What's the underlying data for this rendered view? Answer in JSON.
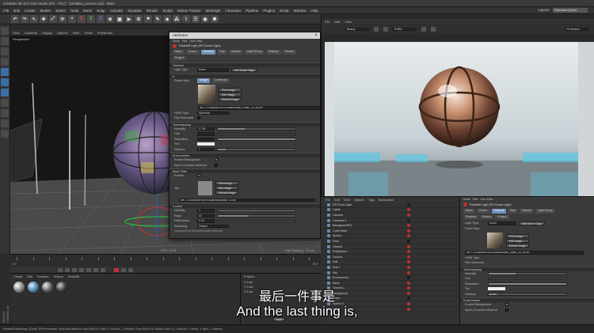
{
  "window": {
    "title": "CINEMA 4D R17.048 Studio (RC - R17) - [Untitled_Lesson.c4d] - Main"
  },
  "menubar": {
    "items": [
      "File",
      "Edit",
      "Create",
      "Modes",
      "Select",
      "Tools",
      "Mesh",
      "Snap",
      "Animate",
      "Simulate",
      "Render",
      "Sculpt",
      "Motion Tracker",
      "MoGraph",
      "Character",
      "Pipeline",
      "Plugins",
      "Script",
      "Window",
      "Help"
    ],
    "layout_label": "Layout:",
    "layout_value": "Standard (User)"
  },
  "toolbar": {
    "axis_x": "X",
    "axis_y": "Y",
    "axis_z": "Z"
  },
  "viewport": {
    "menu": [
      "View",
      "Cameras",
      "Display",
      "Options",
      "Filter",
      "Panel",
      "ProRender"
    ],
    "label": "Perspective",
    "fps": "FPS : 22.8",
    "grid": "Grid Spacing : 10 cm"
  },
  "attributes": {
    "title": "Attributes",
    "header": "Redshift Light (RS Dome Light)",
    "tabs": [
      "Basic",
      "Coord.",
      "General",
      "Ray",
      "Volume",
      "Light Group",
      "Shadow",
      "Photon",
      "Project"
    ],
    "active_tab": "General",
    "general_section": "General",
    "light_type_label": "Light Type",
    "light_type_value": "Dome",
    "add_dome_btn": "Add Dome Cage",
    "texture_map_label": "Dome Map",
    "tex_tab_image": "Image",
    "tex_tab_cubemap": "Cubemap",
    "btn_pick": "Pick Image...",
    "btn_edit": "Edit Image...",
    "btn_reload": "Reload Image",
    "path": "file: C:/Dropbox/HDRI/Studio/studio_small_03_4k.exr",
    "hdri_type_label": "HDRI Type",
    "hdri_type_value": "Spherical",
    "flip_label": "Flip Horizontal",
    "flip_value": "",
    "tone_section": "Tonemapping",
    "exposure_label": "Intensity",
    "exposure_value": "0.794",
    "hue_label": "Hue",
    "saturation_label": "Saturation",
    "tint_label": "Tint",
    "gamma_label": "Gamma",
    "gamma_value": "1",
    "environment_section": "Environment",
    "enable_bg_label": "Enable Background",
    "alpha_label": "Alpha Channel Influence",
    "back_plate_section": "Back Plate",
    "enable_bp_label": "Enable",
    "tex_label": "Tex",
    "bp_path": "file: C:/Dropbox/HDRI/Studio/backplate_01.jpg",
    "control_section": "Control",
    "visibility_label": "Visibility",
    "visibility_value": "1",
    "rays_label": "Rays",
    "rays_value": "64",
    "reflections_label": "Reflections",
    "reflections_value": "0.00",
    "sampling_label": "Sampling",
    "sampling_value": "Default",
    "foot_path": "/Applications/Cinema4D/plugins/Redshift"
  },
  "render_view": {
    "menu": [
      "File",
      "Edit",
      "View"
    ],
    "tool_a": "Beauty",
    "tool_b": "RGBA",
    "tool_c": "Fit Window"
  },
  "object_manager": {
    "menu": [
      "File",
      "Edit",
      "View",
      "Objects",
      "Tags",
      "Bookmarks"
    ],
    "rows": [
      {
        "name": "RS Dome Light",
        "tag": "b"
      },
      {
        "name": "Lights",
        "tag": "r"
      },
      {
        "name": "Camera",
        "tag": "r"
      },
      {
        "name": "Cameras.1",
        "tag": "b"
      },
      {
        "name": "BackgroundFill",
        "tag": "r"
      },
      {
        "name": "Cube.Mesh",
        "tag": "r"
      },
      {
        "name": "Sphere",
        "tag": "r"
      },
      {
        "name": "Floor",
        "tag": "b"
      },
      {
        "name": "Objects",
        "tag": "r"
      },
      {
        "name": "PolySphere",
        "tag": "r"
      },
      {
        "name": "Ground",
        "tag": "r"
      },
      {
        "name": "Null",
        "tag": "r"
      },
      {
        "name": "Null.1",
        "tag": "r"
      },
      {
        "name": "Sky",
        "tag": "r"
      },
      {
        "name": "Environment",
        "tag": "b"
      },
      {
        "name": "Mesh",
        "tag": "r"
      },
      {
        "name": "Ground.1",
        "tag": "r"
      },
      {
        "name": "Background",
        "tag": "r"
      },
      {
        "name": "Plane",
        "tag": "b"
      },
      {
        "name": "Sphere.1",
        "tag": "r"
      },
      {
        "name": "Null.2",
        "tag": "r"
      }
    ]
  },
  "attr_right": {
    "header": "Redshift Light (RS Dome Light)",
    "tabs": [
      "Basic",
      "Coord.",
      "General",
      "Ray",
      "Volume",
      "Light Group",
      "Shadow",
      "Photon",
      "Project"
    ],
    "active_tab": "General",
    "light_type_label": "Light Type",
    "light_type_value": "Dome",
    "add_btn": "Add Dome Cage",
    "texture_label": "Dome Map",
    "btn_pick": "Pick Image...",
    "btn_edit": "Edit Image...",
    "btn_reload": "Reload Image",
    "path": "file: C:/Dropbox/HDRI/Studio/studio_small_03_4k.exr",
    "hdri_label": "HDRI Type",
    "flip_label": "Flip Horizontal",
    "tone_section": "Tonemapping",
    "intensity_label": "Intensity",
    "hue_label": "Hue",
    "sat_label": "Saturation",
    "tint_label": "Tint",
    "gamma_label": "Gamma",
    "env_section": "Environment",
    "enable_bg_label": "Enable Background",
    "alpha_label": "Alpha Channel Influence"
  },
  "timeline": {
    "frame_start": "0 F",
    "frame_end": "90 F"
  },
  "materials": {
    "menu": [
      "Create",
      "Edit",
      "Function",
      "Texture",
      "Redshift"
    ],
    "swatches": [
      "mat",
      "mat",
      "mat",
      "mat"
    ]
  },
  "coords": {
    "header": "Position",
    "x": "X  0 cm",
    "y": "Y  0 cm",
    "z": "Z  0 cm",
    "apply": "Apply"
  },
  "statusbar": "Redshift Warnings: [Dusi]: RPG/renderer TextureId failed to load [sRGB, Path: C:\\Users\\...] Render Time 00:00:00  Scene Size 4 | 1 texture: 1 mesh, 1 light, 1 camera",
  "logo_text": "MAXON CINEMA 4D",
  "subtitle": {
    "cn": "最后一件事是",
    "en": "And the last thing is,"
  },
  "colors": {
    "accent_blue": "#6f8fb8",
    "tag_red": "#c03030",
    "bg_dark": "#2b2b2b"
  }
}
